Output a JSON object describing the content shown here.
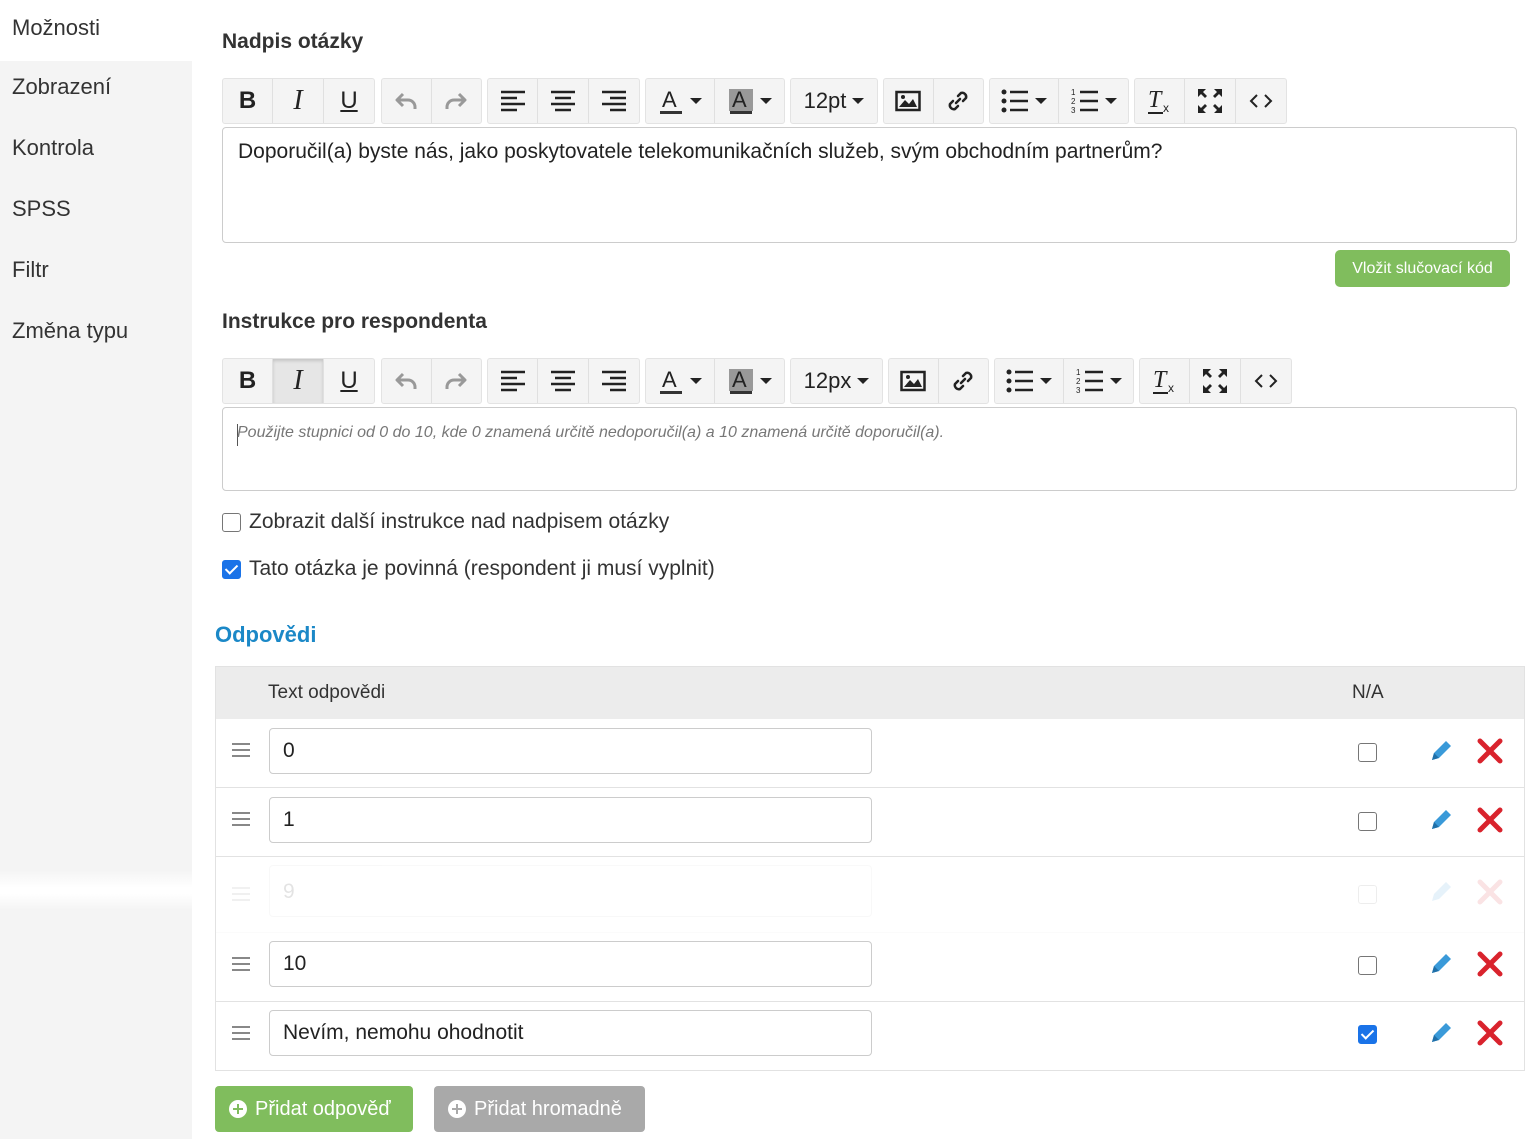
{
  "sidebar": {
    "items": [
      {
        "label": "Možnosti"
      },
      {
        "label": "Zobrazení"
      },
      {
        "label": "Kontrola"
      },
      {
        "label": "SPSS"
      },
      {
        "label": "Filtr"
      },
      {
        "label": "Změna typu"
      }
    ]
  },
  "question": {
    "label": "Nadpis otázky",
    "font_size": "12pt",
    "text": "Doporučil(a) byste nás, jako poskytovatele telekomunikačních služeb, svým obchodním partnerům?",
    "merge_button": "Vložit slučovací kód"
  },
  "instructions": {
    "label": "Instrukce pro respondenta",
    "font_size": "12px",
    "placeholder": "Použijte stupnici od 0 do 10, kde 0 znamená určitě nedoporučil(a) a 10 znamená určitě doporučil(a)."
  },
  "options": {
    "show_above": {
      "label": "Zobrazit další instrukce nad nadpisem otázky",
      "checked": false
    },
    "required": {
      "label": "Tato otázka je povinná (respondent ji musí vyplnit)",
      "checked": true
    }
  },
  "answers": {
    "title": "Odpovědi",
    "col_text": "Text odpovědi",
    "col_na": "N/A",
    "rows": [
      {
        "text": "0",
        "na": false
      },
      {
        "text": "1",
        "na": false
      },
      {
        "text": "9",
        "na": false
      },
      {
        "text": "10",
        "na": false
      },
      {
        "text": "Nevím, nemohu ohodnotit",
        "na": true
      }
    ]
  },
  "buttons": {
    "add_answer": "Přidat odpověď",
    "add_bulk": "Přidat hromadně"
  },
  "colors": {
    "accent_blue": "#1b88c7",
    "green": "#80bd5d",
    "gray_button": "#a9a9a9",
    "delete_red": "#d9232d",
    "edit_blue": "#3a9ad9"
  }
}
